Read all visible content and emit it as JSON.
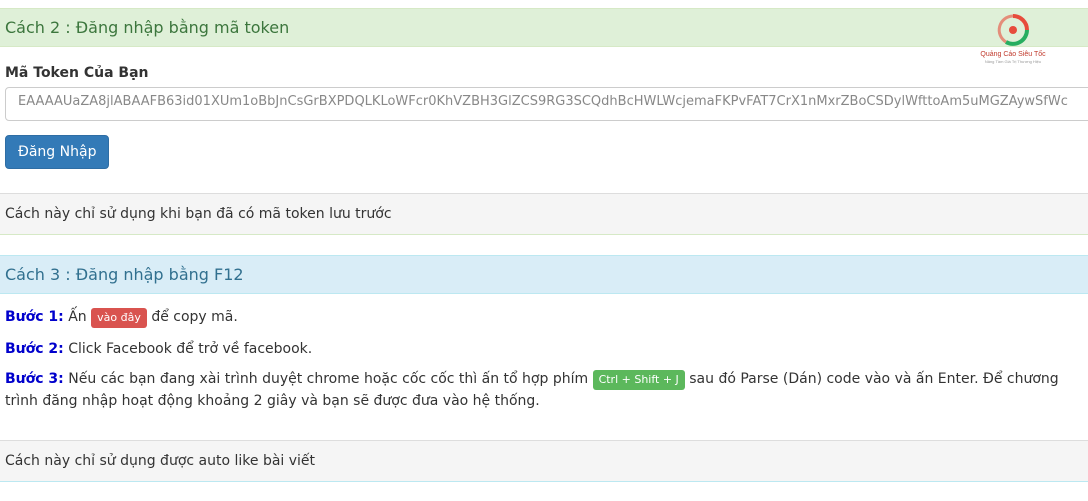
{
  "cach2": {
    "heading": "Cách 2 : Đăng nhập bằng mã token",
    "token_label": "Mã Token Của Bạn",
    "token_value": "EAAAAUaZA8jlABAAFB63id01XUm1oBbJnCsGrBXPDQLKLoWFcr0KhVZBH3GlZCS9RG3SCQdhBcHWLWcjemaFKPvFAT7CrX1nMxrZBoCSDylWfttoAm5uMGZAywSfWc",
    "login_button": "Đăng Nhập",
    "footer": "Cách này chỉ sử dụng khi bạn đã có mã token lưu trước"
  },
  "logo": {
    "name": "Quảng Cáo Siêu Tốc",
    "tagline": "Nâng Tầm Giá Trị Thương Hiệu",
    "colors": [
      "#e74c3c",
      "#27ae60"
    ]
  },
  "cach3": {
    "heading": "Cách 3 : Đăng nhập bằng F12",
    "step1_label": "Bước 1:",
    "step1_pre": "Ấn",
    "step1_badge": "vào đây",
    "step1_post": "để copy mã.",
    "step2_label": "Bước 2:",
    "step2_text": "Click Facebook để trở về facebook.",
    "step3_label": "Bước 3:",
    "step3_pre": "Nếu các bạn đang xài trình duyệt chrome hoặc cốc cốc thì ấn tổ hợp phím",
    "step3_badge": "Ctrl + Shift + J",
    "step3_post": "sau đó Parse (Dán) code vào và ấn Enter. Để chương trình đăng nhập hoạt động khoảng 2 giây và bạn sẽ được đưa vào hệ thống.",
    "footer": "Cách này chỉ sử dụng được auto like bài viết"
  }
}
